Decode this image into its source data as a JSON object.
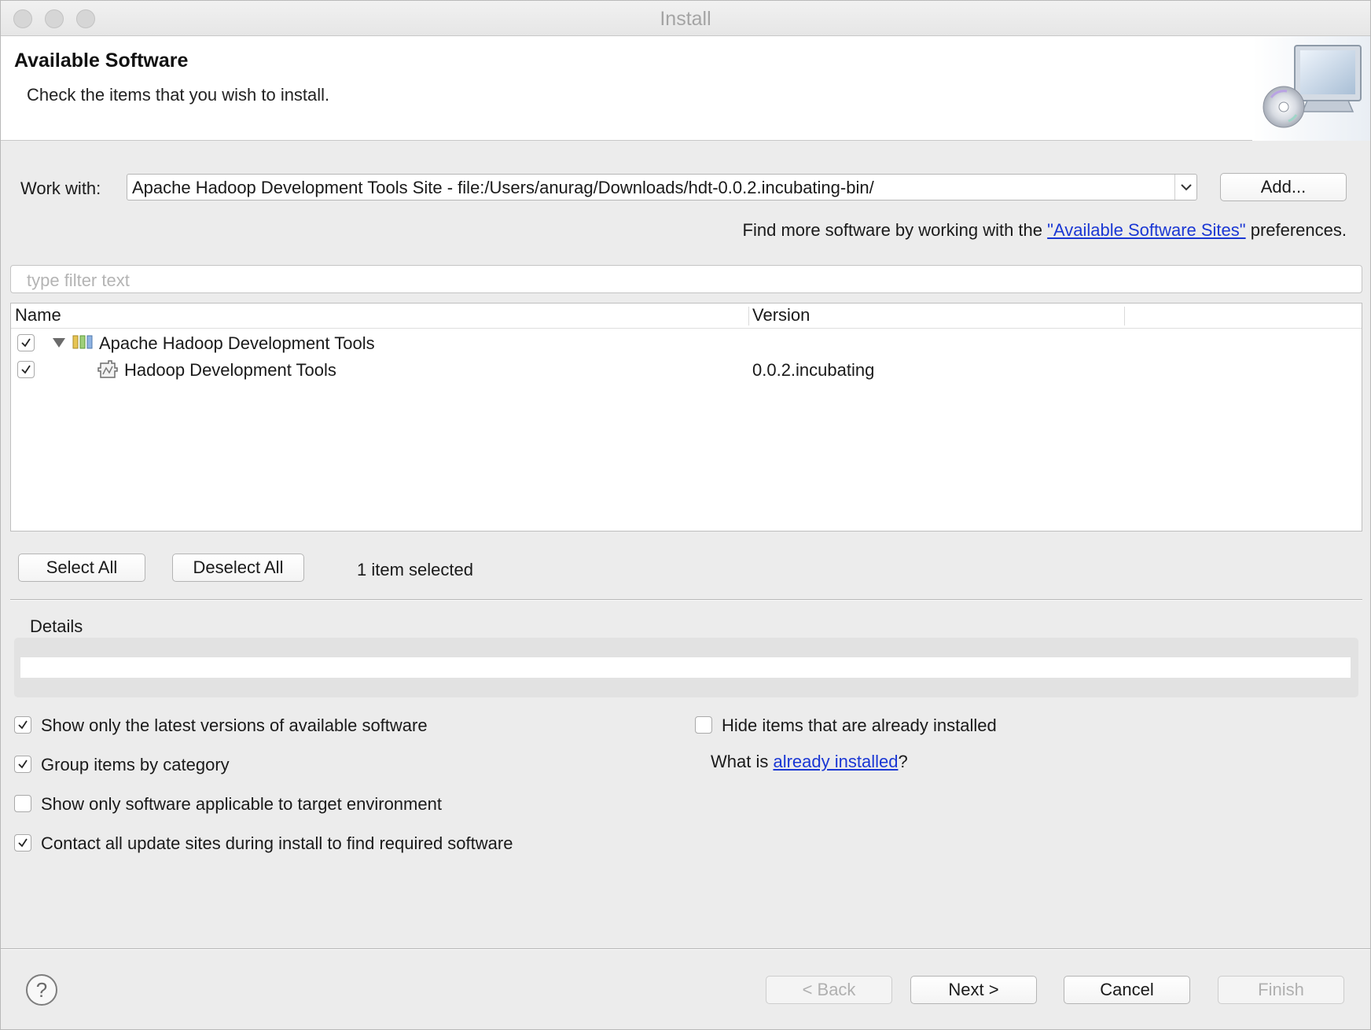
{
  "window": {
    "title": "Install"
  },
  "header": {
    "title": "Available Software",
    "description": "Check the items that you wish to install."
  },
  "work_with": {
    "label": "Work with:",
    "value": "Apache Hadoop Development Tools Site - file:/Users/anurag/Downloads/hdt-0.0.2.incubating-bin/",
    "add_label": "Add..."
  },
  "find_more": {
    "prefix": "Find more software by working with the ",
    "link": "\"Available Software Sites\"",
    "suffix": " preferences."
  },
  "filter": {
    "placeholder": "type filter text"
  },
  "table": {
    "columns": [
      "Name",
      "Version"
    ],
    "rows": [
      {
        "name": "Apache Hadoop Development Tools",
        "version": "",
        "checked": true,
        "expanded": true,
        "icon": "category-icon"
      },
      {
        "name": "Hadoop Development Tools",
        "version": "0.0.2.incubating",
        "checked": true,
        "icon": "feature-icon"
      }
    ]
  },
  "selection": {
    "select_all": "Select All",
    "deselect_all": "Deselect All",
    "status": "1 item selected"
  },
  "details": {
    "label": "Details",
    "value": ""
  },
  "options": {
    "latest": {
      "label": "Show only the latest versions of available software",
      "checked": true
    },
    "group": {
      "label": "Group items by category",
      "checked": true
    },
    "applicable": {
      "label": "Show only software applicable to target environment",
      "checked": false
    },
    "contact": {
      "label": "Contact all update sites during install to find required software",
      "checked": true
    },
    "hide_installed": {
      "label": "Hide items that are already installed",
      "checked": false
    },
    "what_is_prefix": "What is ",
    "what_is_link": "already installed",
    "what_is_suffix": "?"
  },
  "footer": {
    "help": "?",
    "back": "< Back",
    "next": "Next >",
    "cancel": "Cancel",
    "finish": "Finish"
  },
  "colors": {
    "link": "#1a37d4",
    "disabled_text": "#b0b0b0"
  }
}
